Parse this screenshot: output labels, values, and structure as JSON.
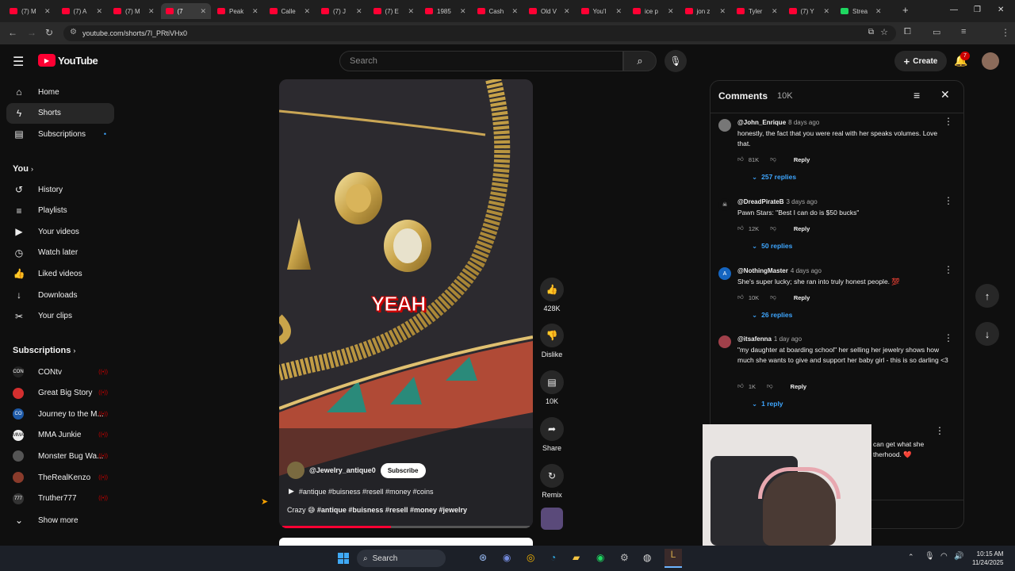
{
  "browser": {
    "tabs": [
      {
        "label": "(7) M",
        "active": false
      },
      {
        "label": "(7) A",
        "active": false
      },
      {
        "label": "(7) M",
        "active": false
      },
      {
        "label": "(7 ",
        "active": true
      },
      {
        "label": "Peak",
        "active": false
      },
      {
        "label": "Calle",
        "active": false
      },
      {
        "label": "(7) J",
        "active": false
      },
      {
        "label": "(7) E",
        "active": false
      },
      {
        "label": "1985",
        "active": false
      },
      {
        "label": "Cash",
        "active": false
      },
      {
        "label": "Old V",
        "active": false
      },
      {
        "label": "You'l",
        "active": false
      },
      {
        "label": "ice p",
        "active": false
      },
      {
        "label": "jon z",
        "active": false
      },
      {
        "label": "Tyler",
        "active": false
      },
      {
        "label": "(7) Y",
        "active": false
      },
      {
        "label": "Strea",
        "active": false
      }
    ],
    "url": "youtube.com/shorts/7l_PRtiVHx0"
  },
  "header": {
    "logo_text": "YouTube",
    "search_placeholder": "Search",
    "create_label": "Create",
    "notification_count": "7"
  },
  "sidebar": {
    "main": [
      {
        "label": "Home",
        "icon": "home-icon"
      },
      {
        "label": "Shorts",
        "icon": "shorts-icon"
      },
      {
        "label": "Subscriptions",
        "icon": "subscriptions-icon"
      }
    ],
    "you_heading": "You",
    "you_items": [
      {
        "label": "History",
        "icon": "history-icon"
      },
      {
        "label": "Playlists",
        "icon": "playlists-icon"
      },
      {
        "label": "Your videos",
        "icon": "your-videos-icon"
      },
      {
        "label": "Watch later",
        "icon": "watch-later-icon"
      },
      {
        "label": "Liked videos",
        "icon": "liked-videos-icon"
      },
      {
        "label": "Downloads",
        "icon": "downloads-icon"
      },
      {
        "label": "Your clips",
        "icon": "clips-icon"
      }
    ],
    "subs_heading": "Subscriptions",
    "subs": [
      {
        "label": "CONtv",
        "avatar_text": "CON",
        "color": "#222222"
      },
      {
        "label": "Great Big Story",
        "avatar_text": "",
        "color": "#d32f2f"
      },
      {
        "label": "Journey to the M...",
        "avatar_text": "CO",
        "color": "#1e5aa8"
      },
      {
        "label": "MMA Junkie",
        "avatar_text": "MMA",
        "color": "#eeeeee"
      },
      {
        "label": "Monster Bug Wa...",
        "avatar_text": "",
        "color": "#555555"
      },
      {
        "label": "TheRealKenzo",
        "avatar_text": "",
        "color": "#8a3b2b"
      },
      {
        "label": "Truther777",
        "avatar_text": "777",
        "color": "#333333"
      }
    ],
    "show_more": "Show more"
  },
  "video": {
    "caption_overlay": "YEAH",
    "channel": "@Jewelry_antique0",
    "subscribe_label": "Subscribe",
    "tags_line": "#antique #buisness #resell #money #coins",
    "description_prefix": "Crazy 😅",
    "description_tags": "#antique #buisness #resell #money #jewelry",
    "progress": 0.44
  },
  "actions": {
    "like_count": "428K",
    "dislike_label": "Dislike",
    "comments_count": "10K",
    "share_label": "Share",
    "remix_label": "Remix"
  },
  "comments": {
    "title": "Comments",
    "count": "10K",
    "items": [
      {
        "author": "@John_Enrique",
        "time": "8 days ago",
        "text": "honestly, the fact that you were real with her speaks volumes. Love that.",
        "likes": "81K",
        "reply_label": "Reply",
        "replies": "257 replies",
        "avatar_color": "#777777",
        "avatar_text": ""
      },
      {
        "author": "@DreadPirateB",
        "time": "3 days ago",
        "text": "Pawn Stars: \"Best I can do is $50 bucks\"",
        "likes": "12K",
        "reply_label": "Reply",
        "replies": "50 replies",
        "avatar_color": "#0f0f0f",
        "avatar_text": "☠"
      },
      {
        "author": "@NothingMaster",
        "time": "4 days ago",
        "text": "She's super lucky; she ran into truly honest people. 💯",
        "likes": "10K",
        "reply_label": "Reply",
        "replies": "26 replies",
        "avatar_color": "#1565c0",
        "avatar_text": "A"
      },
      {
        "author": "@itsafenna",
        "time": "1 day ago",
        "text": "\"my daughter at boarding school\" her selling her jewelry shows how much she wants to give and support her baby girl - this is so darling <3",
        "likes": "1K",
        "reply_label": "Reply",
        "replies": "1 reply",
        "avatar_color": "#a0404a",
        "avatar_text": ""
      }
    ],
    "partial_text_1": "can get what she",
    "partial_text_2": "therhood. ❤️"
  },
  "taskbar": {
    "search_label": "Search",
    "time": "10:15 AM",
    "date": "11/24/2025"
  },
  "colors": {
    "accent_red": "#ff0033",
    "link_blue": "#3ea6ff",
    "bg": "#0f0f0f"
  }
}
